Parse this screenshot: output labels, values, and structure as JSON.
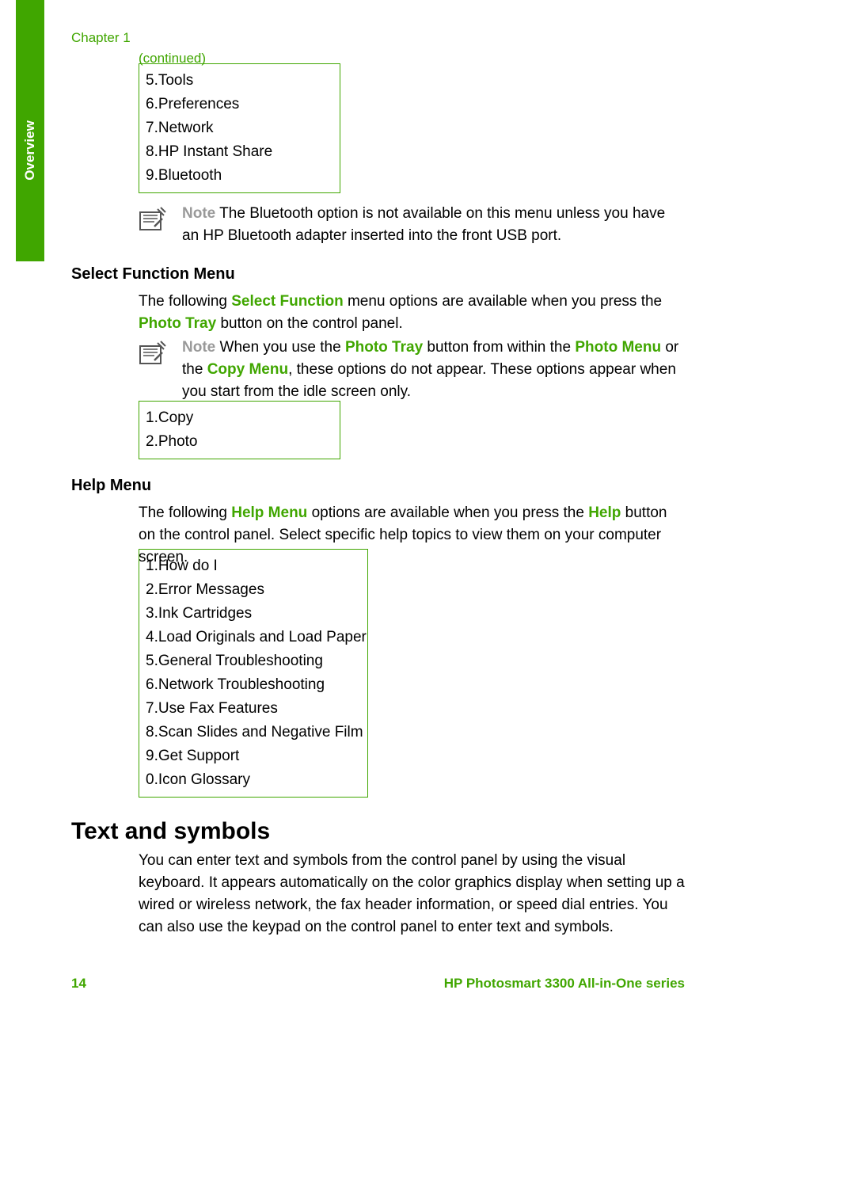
{
  "side_tab": "Overview",
  "chapter": "Chapter 1",
  "continued": "(continued)",
  "setup_menu_cont": [
    "5.Tools",
    "6.Preferences",
    "7.Network",
    "8.HP Instant Share",
    "9.Bluetooth"
  ],
  "note1": {
    "lead": "Note",
    "text_a": "  The Bluetooth option is not available on this menu unless you have an HP Bluetooth adapter inserted into the front USB port."
  },
  "heading_select": "Select Function Menu",
  "select_para": {
    "a": "The following ",
    "g1": "Select Function",
    "b": " menu options are available when you press the ",
    "g2": "Photo Tray",
    "c": " button on the control panel."
  },
  "note2": {
    "lead": "Note",
    "a": "  When you use the ",
    "g1": "Photo Tray",
    "b": " button from within the ",
    "g2": "Photo Menu",
    "c": " or the ",
    "g3": "Copy Menu",
    "d": ", these options do not appear. These options appear when you start from the idle screen only."
  },
  "select_function_menu": [
    "1.Copy",
    "2.Photo"
  ],
  "heading_help": "Help Menu",
  "help_para": {
    "a": "The following ",
    "g1": "Help Menu",
    "b": " options are available when you press the ",
    "g2": "Help",
    "c": " button on the control panel. Select specific help topics to view them on your computer screen."
  },
  "help_menu": [
    "1.How do I",
    "2.Error Messages",
    "3.Ink Cartridges",
    "4.Load Originals and Load Paper",
    "5.General Troubleshooting",
    "6.Network Troubleshooting",
    "7.Use Fax Features",
    "8.Scan Slides and Negative Film",
    "9.Get Support",
    "0.Icon Glossary"
  ],
  "heading_text_symbols": "Text and symbols",
  "text_symbols_para": "You can enter text and symbols from the control panel by using the visual keyboard. It appears automatically on the color graphics display when setting up a wired or wireless network, the fax header information, or speed dial entries. You can also use the keypad on the control panel to enter text and symbols.",
  "page_number": "14",
  "footer": "HP Photosmart 3300 All-in-One series"
}
